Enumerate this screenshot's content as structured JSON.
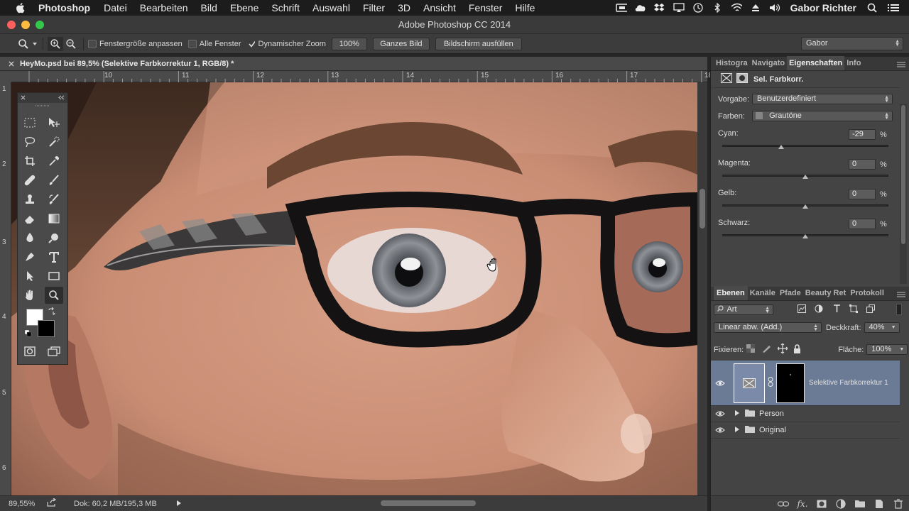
{
  "menubar": {
    "app_name": "Photoshop",
    "items": [
      "Datei",
      "Bearbeiten",
      "Bild",
      "Ebene",
      "Schrift",
      "Auswahl",
      "Filter",
      "3D",
      "Ansicht",
      "Fenster",
      "Hilfe"
    ],
    "user": "Gabor Richter"
  },
  "window": {
    "title": "Adobe Photoshop CC 2014"
  },
  "options_bar": {
    "resize_windows_label": "Fenstergröße anpassen",
    "all_windows_label": "Alle Fenster",
    "scrubby_zoom_label": "Dynamischer Zoom",
    "scrubby_zoom_checked": true,
    "btn_100": "100%",
    "btn_fit": "Ganzes Bild",
    "btn_fill": "Bildschirm ausfüllen",
    "workspace": "Gabor"
  },
  "document": {
    "tab_title": "HeyMo.psd bei 89,5% (Selektive Farbkorrektur 1, RGB/8) *",
    "ruler_h": [
      "10",
      "11",
      "12",
      "13",
      "14",
      "15",
      "16",
      "17",
      "18"
    ],
    "ruler_v": [
      "1",
      "2",
      "3",
      "4",
      "5",
      "6"
    ]
  },
  "status": {
    "zoom": "89,55%",
    "doc_size": "Dok: 60,2 MB/195,3 MB"
  },
  "properties_panel": {
    "tabs": [
      "Histogra",
      "Navigato",
      "Eigenschaften",
      "Info"
    ],
    "active_tab": "Eigenschaften",
    "title": "Sel. Farbkorr.",
    "preset_label": "Vorgabe:",
    "preset_value": "Benutzerdefiniert",
    "colors_label": "Farben:",
    "colors_value": "Grautöne",
    "sliders": [
      {
        "label": "Cyan:",
        "value": "-29",
        "unit": "%",
        "pos": -29
      },
      {
        "label": "Magenta:",
        "value": "0",
        "unit": "%",
        "pos": 0
      },
      {
        "label": "Gelb:",
        "value": "0",
        "unit": "%",
        "pos": 0
      },
      {
        "label": "Schwarz:",
        "value": "0",
        "unit": "%",
        "pos": 0
      }
    ]
  },
  "layers_panel": {
    "tabs": [
      "Ebenen",
      "Kanäle",
      "Pfade",
      "Beauty Ret",
      "Protokoll"
    ],
    "active_tab": "Ebenen",
    "filter_value": "Art",
    "blend_mode": "Linear abw. (Add.)",
    "opacity_label": "Deckkraft:",
    "opacity_value": "40%",
    "lock_label": "Fixieren:",
    "fill_label": "Fläche:",
    "fill_value": "100%",
    "layers": [
      {
        "name": "Selektive Farbkorrektur 1"
      },
      {
        "name": "Person"
      },
      {
        "name": "Original"
      }
    ]
  },
  "colors": {
    "foreground": "#ffffff",
    "background": "#000000",
    "selection": "#6b7b96"
  }
}
